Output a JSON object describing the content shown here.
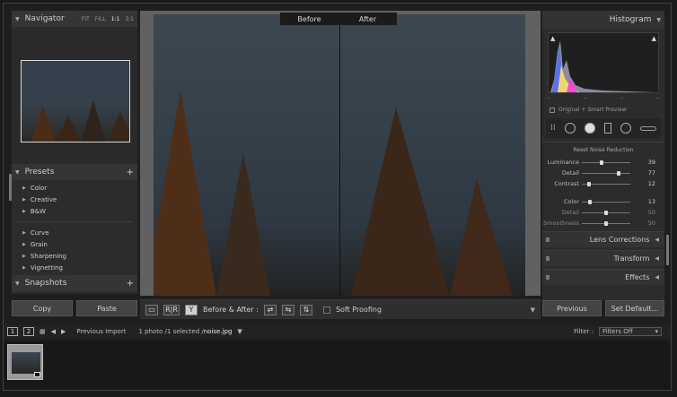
{
  "left_panel": {
    "navigator": {
      "title": "Navigator",
      "zoom_options": [
        "FIT",
        "FILL",
        "1:1",
        "3:1"
      ],
      "zoom_active": "1:1"
    },
    "presets": {
      "title": "Presets",
      "groups_a": [
        "Color",
        "Creative",
        "B&W"
      ],
      "groups_b": [
        "Curve",
        "Grain",
        "Sharpening",
        "Vignetting"
      ]
    },
    "snapshots": {
      "title": "Snapshots"
    },
    "copy_label": "Copy",
    "paste_label": "Paste"
  },
  "center": {
    "before_label": "Before",
    "after_label": "After",
    "toolbar": {
      "before_after_label": "Before & After :",
      "soft_proofing_label": "Soft Proofing"
    }
  },
  "right_panel": {
    "histogram": {
      "title": "Histogram",
      "preview_status": "Original + Smart Preview"
    },
    "noise_reduction": {
      "title": "Reset Noise Reduction",
      "luminance": [
        {
          "label": "Luminance",
          "value": "39",
          "level": 0.39
        },
        {
          "label": "Detail",
          "value": "77",
          "level": 0.77
        },
        {
          "label": "Contrast",
          "value": "12",
          "level": 0.12
        }
      ],
      "color": [
        {
          "label": "Color",
          "value": "13",
          "level": 0.13
        },
        {
          "label": "Detail",
          "value": "50",
          "level": 0.5
        },
        {
          "label": "Smoothness",
          "value": "50",
          "level": 0.5
        }
      ]
    },
    "sections": [
      "Lens Corrections",
      "Transform",
      "Effects"
    ],
    "previous_label": "Previous",
    "set_default_label": "Set Default..."
  },
  "filmstrip": {
    "page_1": "1",
    "page_2": "2",
    "source": "Previous Import",
    "count_text": "1 photo /1 selected /",
    "filename": "noise.jpg",
    "filter_label": "Filter :",
    "filter_value": "Filters Off"
  }
}
